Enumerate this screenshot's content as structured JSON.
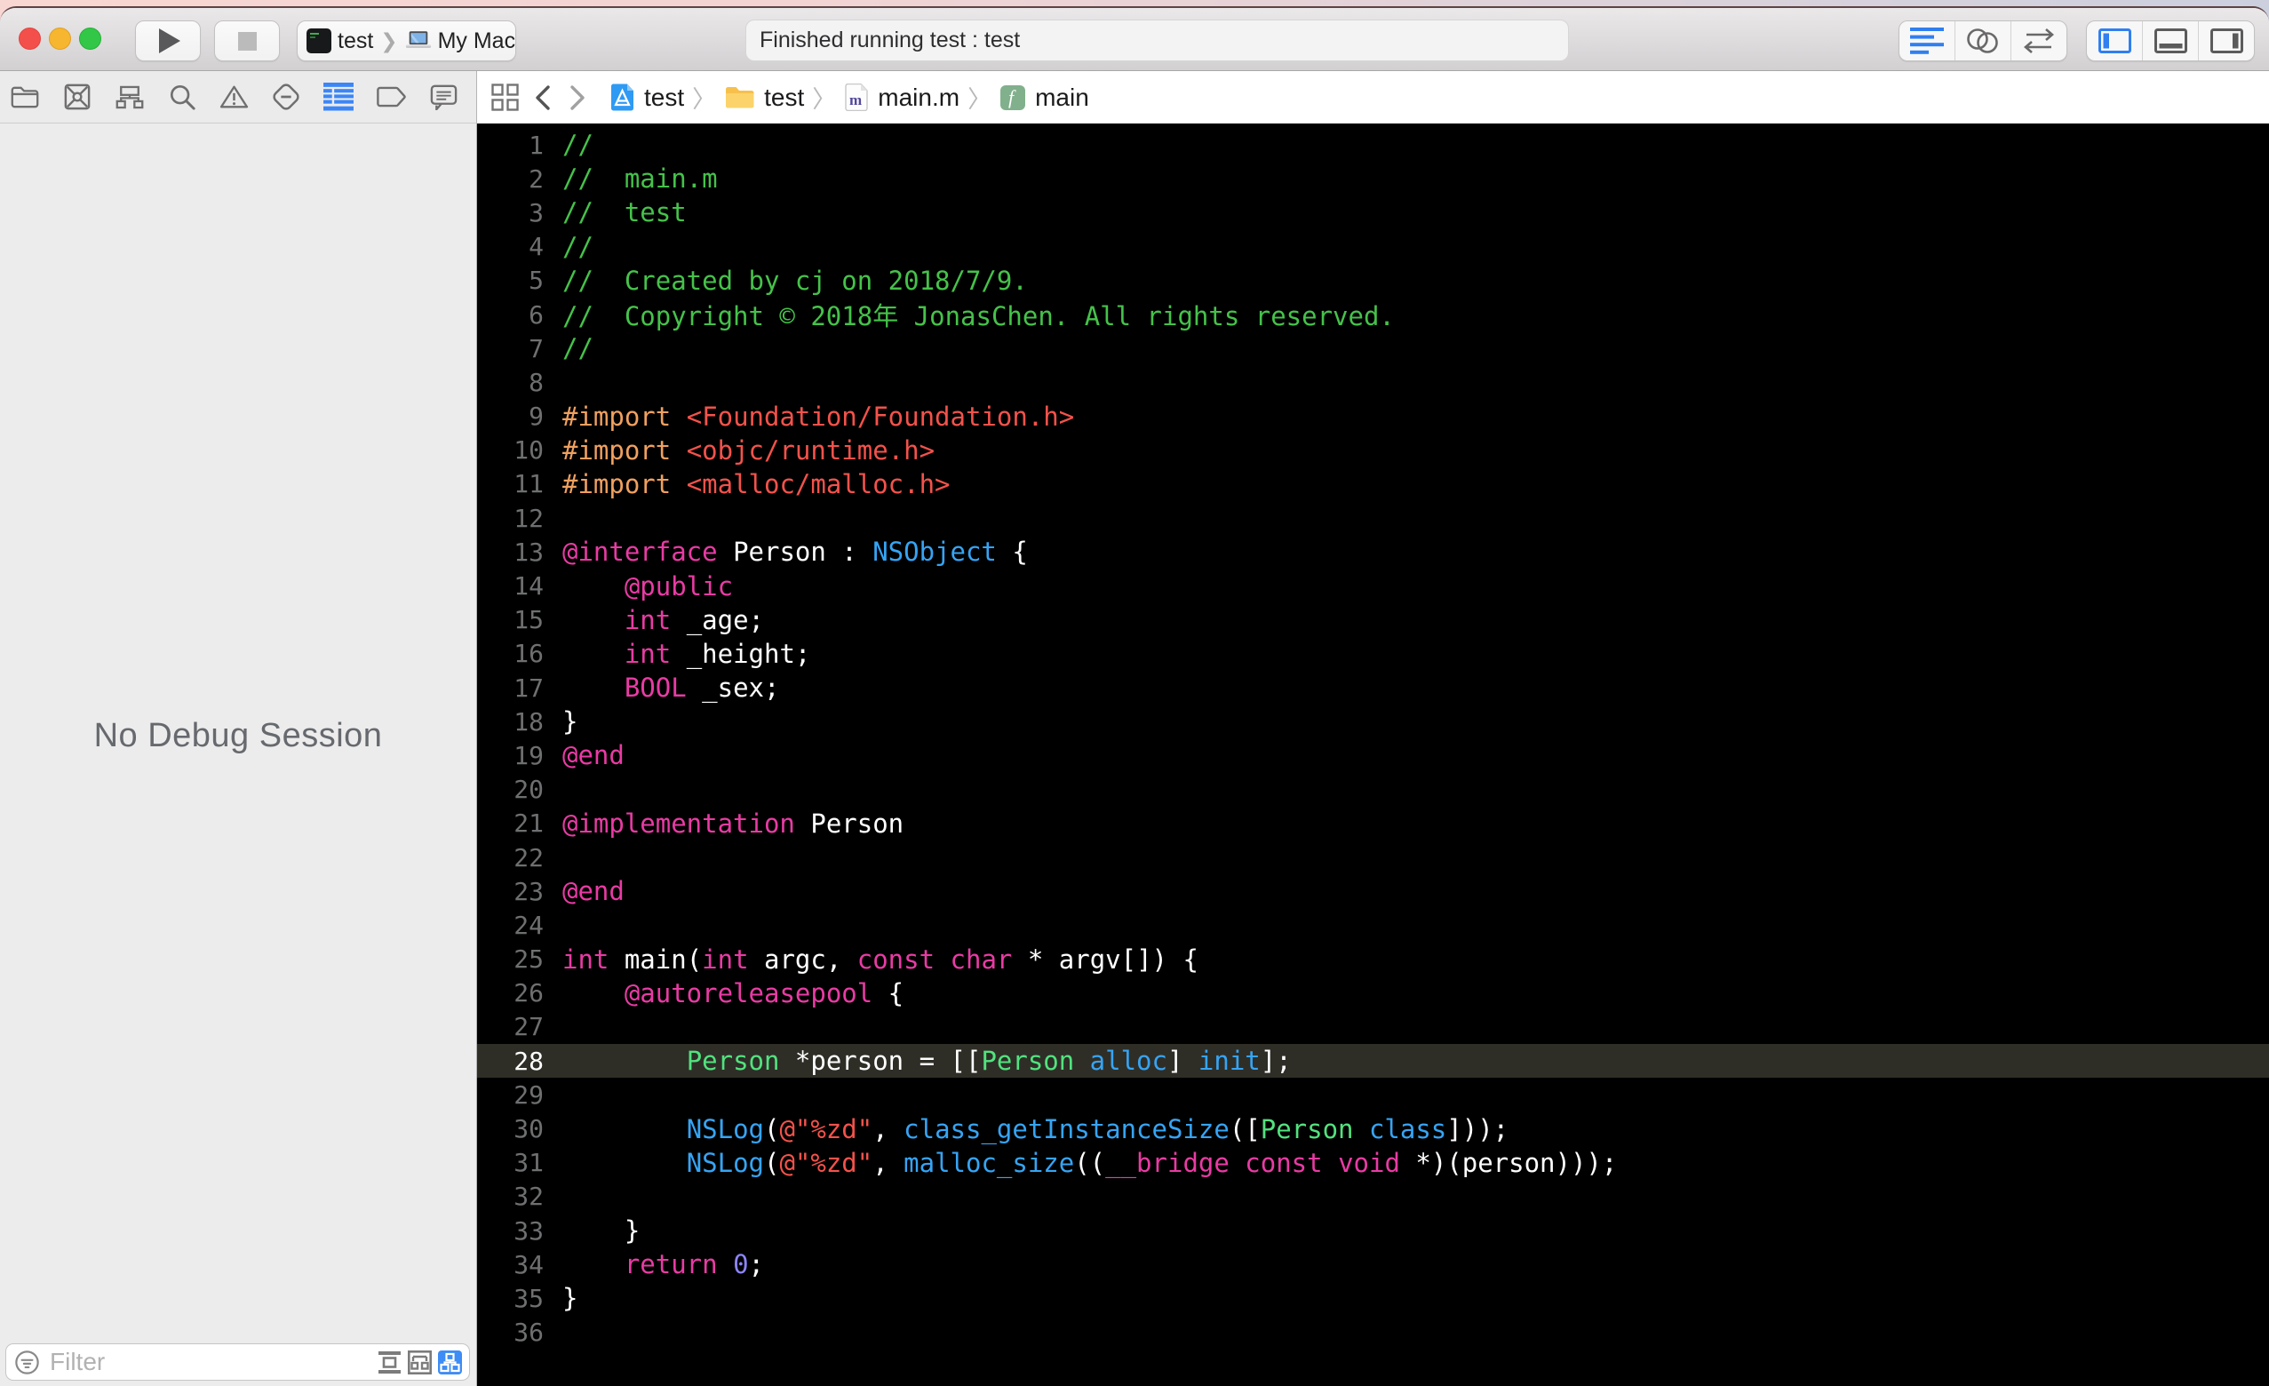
{
  "colors": {
    "accent_blue": "#2f7ff0",
    "editor_bg": "#000000",
    "highlight_line_bg": "#2e2e27",
    "comment_green": "#45c24a",
    "preprocessor_orange": "#f0a05f",
    "string_red": "#f4524b",
    "keyword_pink": "#e93ba4",
    "method_blue": "#36a4f4",
    "class_green": "#52e27e",
    "number_purple": "#8c85f9",
    "plain_white": "#ffffff",
    "panel_bg": "#edecec",
    "traffic_red": "#f4504b",
    "traffic_yellow": "#f6b62f",
    "traffic_green": "#33c748"
  },
  "toolbar": {
    "scheme": {
      "project": "test",
      "destination": "My Mac"
    },
    "status_text": "Finished running test : test",
    "editor_modes": [
      "standard-editor",
      "assistant-editor",
      "version-editor"
    ],
    "selected_editor_mode": "standard-editor",
    "panel_toggles": [
      "navigator-panel",
      "debug-area",
      "inspectors-panel"
    ],
    "active_panel_toggle": "navigator-panel"
  },
  "navigator": {
    "icons": [
      "project-navigator",
      "source-control-navigator",
      "symbol-navigator",
      "find-navigator",
      "issue-navigator",
      "test-navigator",
      "debug-navigator",
      "breakpoint-navigator",
      "report-navigator"
    ],
    "selected_icon": "debug-navigator",
    "empty_text": "No Debug Session",
    "filter_placeholder": "Filter",
    "filter_modes": [
      "flat-view",
      "grouped-view",
      "hierarchy-view"
    ],
    "selected_filter_mode": "hierarchy-view"
  },
  "jumpbar": {
    "crumbs": [
      {
        "icon": "project-file-icon",
        "label": "test"
      },
      {
        "icon": "folder-icon",
        "label": "test"
      },
      {
        "icon": "objc-file-icon",
        "label": "main.m"
      },
      {
        "icon": "function-icon",
        "label": "main"
      }
    ],
    "separator": "〉"
  },
  "editor": {
    "language": "objective-c",
    "highlighted_line": 28,
    "lines": [
      {
        "n": 1,
        "segs": [
          [
            "c",
            "//"
          ]
        ]
      },
      {
        "n": 2,
        "segs": [
          [
            "c",
            "//  main.m"
          ]
        ]
      },
      {
        "n": 3,
        "segs": [
          [
            "c",
            "//  test"
          ]
        ]
      },
      {
        "n": 4,
        "segs": [
          [
            "c",
            "//"
          ]
        ]
      },
      {
        "n": 5,
        "segs": [
          [
            "c",
            "//  Created by cj on 2018/7/9."
          ]
        ]
      },
      {
        "n": 6,
        "segs": [
          [
            "c",
            "//  Copyright © 2018年 JonasChen. All rights reserved."
          ]
        ]
      },
      {
        "n": 7,
        "segs": [
          [
            "c",
            "//"
          ]
        ]
      },
      {
        "n": 8,
        "segs": []
      },
      {
        "n": 9,
        "segs": [
          [
            "o",
            "#import "
          ],
          [
            "r",
            "<Foundation/Foundation.h>"
          ]
        ]
      },
      {
        "n": 10,
        "segs": [
          [
            "o",
            "#import "
          ],
          [
            "r",
            "<objc/runtime.h>"
          ]
        ]
      },
      {
        "n": 11,
        "segs": [
          [
            "o",
            "#import "
          ],
          [
            "r",
            "<malloc/malloc.h>"
          ]
        ]
      },
      {
        "n": 12,
        "segs": []
      },
      {
        "n": 13,
        "segs": [
          [
            "k",
            "@interface"
          ],
          [
            "w",
            " Person : "
          ],
          [
            "b",
            "NSObject"
          ],
          [
            "w",
            " {"
          ]
        ]
      },
      {
        "n": 14,
        "segs": [
          [
            "w",
            "    "
          ],
          [
            "k",
            "@public"
          ]
        ]
      },
      {
        "n": 15,
        "segs": [
          [
            "w",
            "    "
          ],
          [
            "k",
            "int"
          ],
          [
            "w",
            " _age;"
          ]
        ]
      },
      {
        "n": 16,
        "segs": [
          [
            "w",
            "    "
          ],
          [
            "k",
            "int"
          ],
          [
            "w",
            " _height;"
          ]
        ]
      },
      {
        "n": 17,
        "segs": [
          [
            "w",
            "    "
          ],
          [
            "k",
            "BOOL"
          ],
          [
            "w",
            " _sex;"
          ]
        ]
      },
      {
        "n": 18,
        "segs": [
          [
            "w",
            "}"
          ]
        ]
      },
      {
        "n": 19,
        "segs": [
          [
            "k",
            "@end"
          ]
        ]
      },
      {
        "n": 20,
        "segs": []
      },
      {
        "n": 21,
        "segs": [
          [
            "k",
            "@implementation"
          ],
          [
            "w",
            " Person"
          ]
        ]
      },
      {
        "n": 22,
        "segs": []
      },
      {
        "n": 23,
        "segs": [
          [
            "k",
            "@end"
          ]
        ]
      },
      {
        "n": 24,
        "segs": []
      },
      {
        "n": 25,
        "segs": [
          [
            "k",
            "int"
          ],
          [
            "w",
            " main("
          ],
          [
            "k",
            "int"
          ],
          [
            "w",
            " argc, "
          ],
          [
            "k",
            "const"
          ],
          [
            "w",
            " "
          ],
          [
            "k",
            "char"
          ],
          [
            "w",
            " * argv[]) {"
          ]
        ]
      },
      {
        "n": 26,
        "segs": [
          [
            "w",
            "    "
          ],
          [
            "k",
            "@autoreleasepool"
          ],
          [
            "w",
            " {"
          ]
        ]
      },
      {
        "n": 27,
        "segs": []
      },
      {
        "n": 28,
        "segs": [
          [
            "w",
            "        "
          ],
          [
            "g",
            "Person"
          ],
          [
            "w",
            " *person = [["
          ],
          [
            "g",
            "Person"
          ],
          [
            "w",
            " "
          ],
          [
            "b",
            "alloc"
          ],
          [
            "w",
            "] "
          ],
          [
            "b",
            "init"
          ],
          [
            "w",
            "];"
          ]
        ]
      },
      {
        "n": 29,
        "segs": []
      },
      {
        "n": 30,
        "segs": [
          [
            "w",
            "        "
          ],
          [
            "b",
            "NSLog"
          ],
          [
            "w",
            "("
          ],
          [
            "r",
            "@\"%zd\""
          ],
          [
            "w",
            ", "
          ],
          [
            "b",
            "class_getInstanceSize"
          ],
          [
            "w",
            "(["
          ],
          [
            "g",
            "Person"
          ],
          [
            "w",
            " "
          ],
          [
            "b",
            "class"
          ],
          [
            "w",
            "]));"
          ]
        ]
      },
      {
        "n": 31,
        "segs": [
          [
            "w",
            "        "
          ],
          [
            "b",
            "NSLog"
          ],
          [
            "w",
            "("
          ],
          [
            "r",
            "@\"%zd\""
          ],
          [
            "w",
            ", "
          ],
          [
            "b",
            "malloc_size"
          ],
          [
            "w",
            "(("
          ],
          [
            "k",
            "__bridge"
          ],
          [
            "w",
            " "
          ],
          [
            "k",
            "const"
          ],
          [
            "w",
            " "
          ],
          [
            "k",
            "void"
          ],
          [
            "w",
            " *)(person)));"
          ]
        ]
      },
      {
        "n": 32,
        "segs": []
      },
      {
        "n": 33,
        "segs": [
          [
            "w",
            "    }"
          ]
        ]
      },
      {
        "n": 34,
        "segs": [
          [
            "w",
            "    "
          ],
          [
            "k",
            "return"
          ],
          [
            "w",
            " "
          ],
          [
            "u",
            "0"
          ],
          [
            "w",
            ";"
          ]
        ]
      },
      {
        "n": 35,
        "segs": [
          [
            "w",
            "}"
          ]
        ]
      },
      {
        "n": 36,
        "segs": []
      }
    ]
  }
}
